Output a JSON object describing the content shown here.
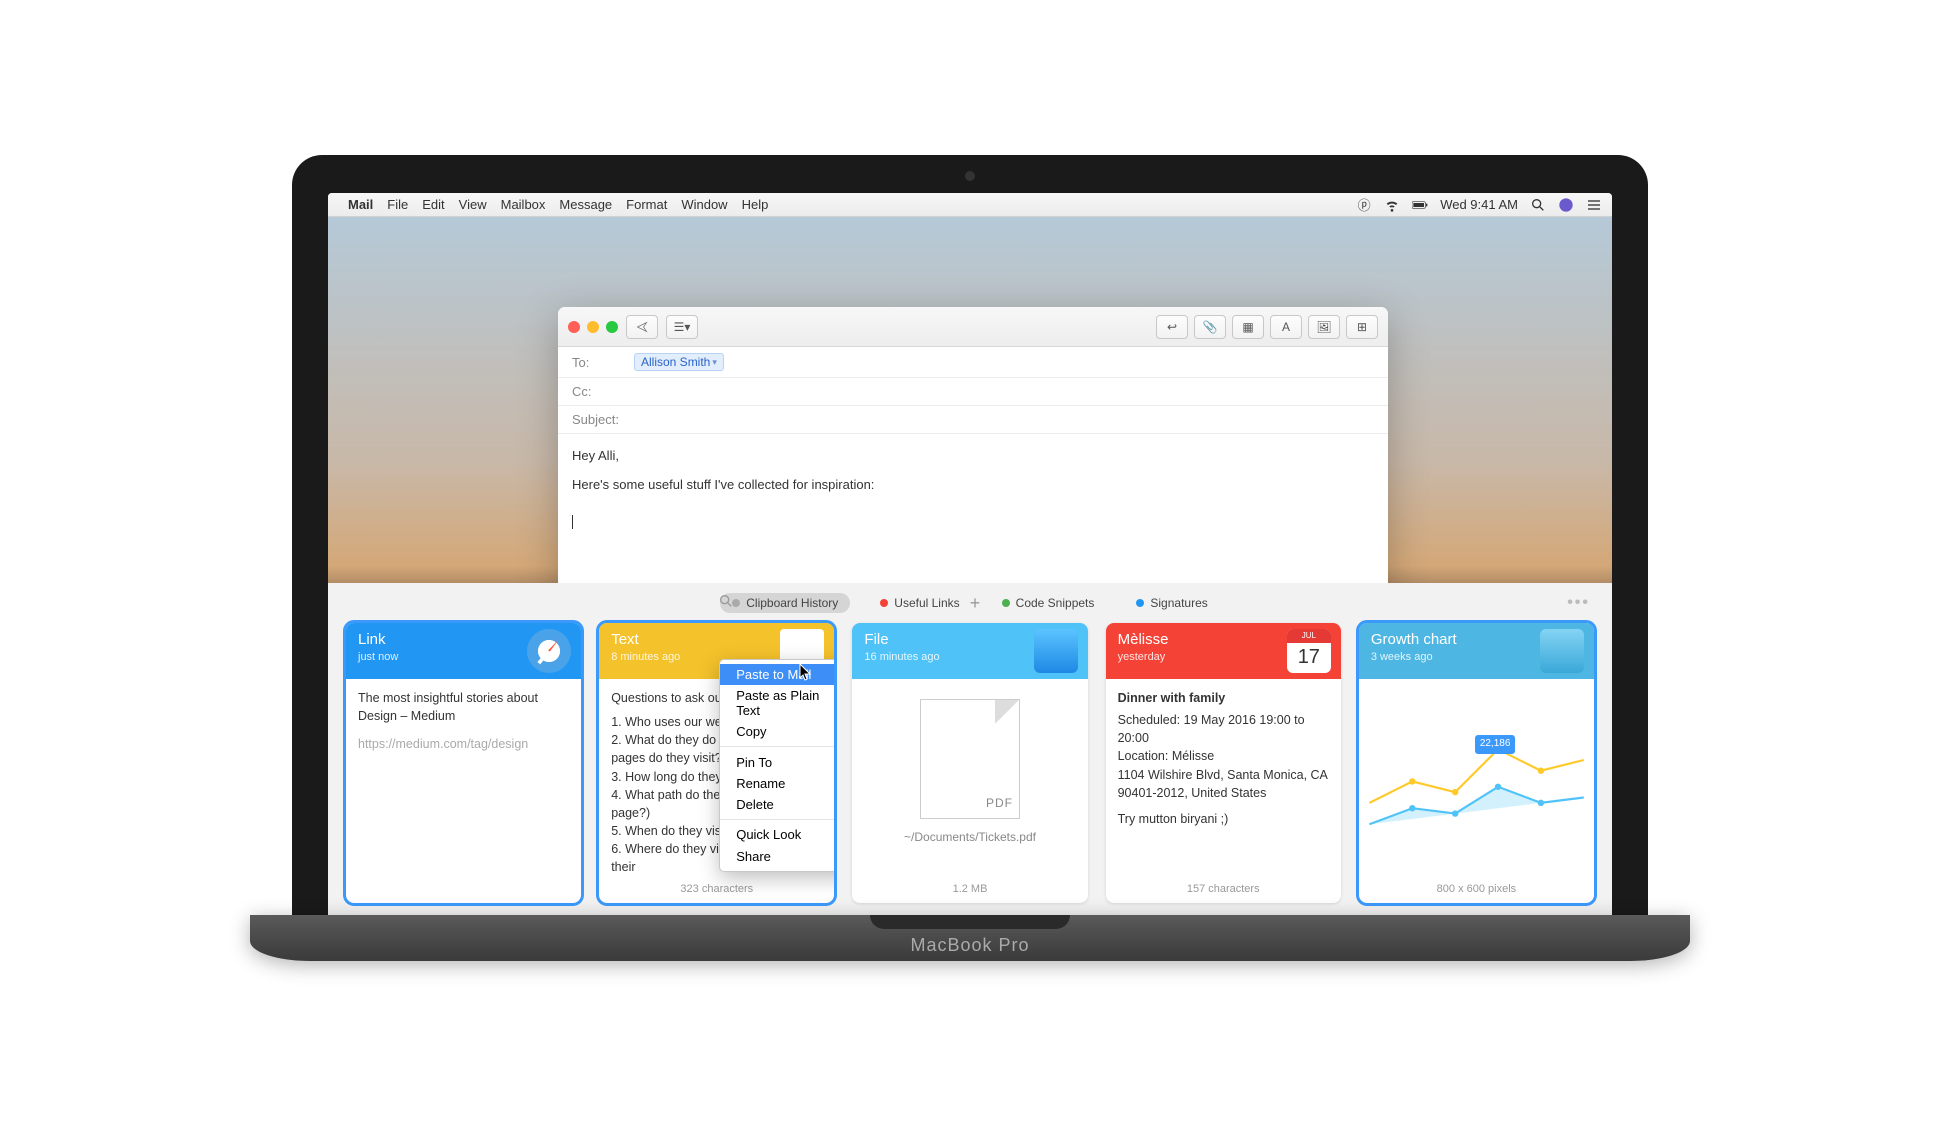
{
  "menubar": {
    "app": "Mail",
    "items": [
      "File",
      "Edit",
      "View",
      "Mailbox",
      "Message",
      "Format",
      "Window",
      "Help"
    ],
    "right": {
      "clock": "Wed 9:41 AM"
    }
  },
  "mail": {
    "to_label": "To:",
    "cc_label": "Cc:",
    "subject_label": "Subject:",
    "recipient": "Allison Smith",
    "body_line1": "Hey Alli,",
    "body_line2": "Here's some useful stuff I've collected for inspiration:"
  },
  "panel": {
    "tabs": {
      "history": "Clipboard History",
      "links": "Useful Links",
      "snippets": "Code Snippets",
      "signatures": "Signatures"
    },
    "colors": {
      "history": "#aaaaaa",
      "links": "#f44336",
      "snippets": "#4caf50",
      "signatures": "#2196f3"
    }
  },
  "cards": [
    {
      "type": "Link",
      "meta": "just now",
      "color": "bg-blue",
      "body_title": "The most insightful stories about Design – Medium",
      "body_sub": "https://medium.com/tag/design",
      "foot": ""
    },
    {
      "type": "Text",
      "meta": "8 minutes ago",
      "color": "bg-yellow",
      "body_title": "Questions to ask ourselves",
      "body_lines": [
        "1. Who uses our website?",
        "2. What do they do there? (Which pages do they visit?)",
        "3. How long do they visit?",
        "4. What path do they take? (landing page?)",
        "5. When do they visit? (peak time?)",
        "6. Where do they visit from? (What is their"
      ],
      "foot": "323 characters"
    },
    {
      "type": "File",
      "meta": "16 minutes ago",
      "color": "bg-sky",
      "file_path": "~/Documents/Tickets.pdf",
      "foot": "1.2 MB"
    },
    {
      "type": "Mèlisse",
      "meta": "yesterday",
      "color": "bg-red",
      "cal_month": "JUL",
      "cal_day": "17",
      "body_title": "Dinner with family",
      "body_lines": [
        "Scheduled: 19 May 2016 19:00 to 20:00",
        "Location: Mélisse",
        "1104 Wilshire Blvd, Santa Monica, CA 90401-2012, United States",
        "",
        "Try mutton biryani ;)"
      ],
      "foot": "157 characters"
    },
    {
      "type": "Growth chart",
      "meta": "3 weeks ago",
      "color": "bg-teal",
      "chart_badge": "22,186",
      "foot": "800 x 600 pixels"
    }
  ],
  "context_menu": {
    "items": [
      {
        "label": "Paste to Mail",
        "hl": true
      },
      {
        "label": "Paste as Plain Text"
      },
      {
        "label": "Copy"
      },
      {
        "sep": true
      },
      {
        "label": "Pin To",
        "sub": true
      },
      {
        "label": "Rename"
      },
      {
        "label": "Delete"
      },
      {
        "sep": true
      },
      {
        "label": "Quick Look"
      },
      {
        "label": "Share",
        "sub": true
      }
    ]
  },
  "laptop_label": "MacBook Pro"
}
